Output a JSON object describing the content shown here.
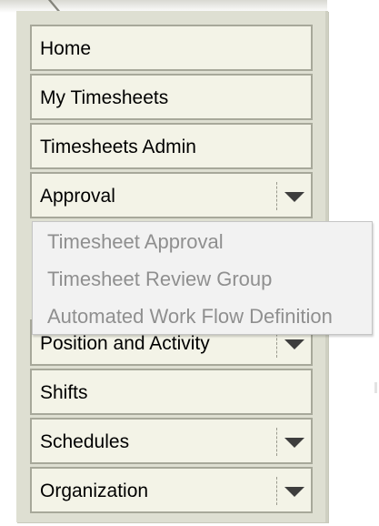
{
  "menu": {
    "items": [
      {
        "label": "Home",
        "has_dropdown": false
      },
      {
        "label": "My Timesheets",
        "has_dropdown": false
      },
      {
        "label": "Timesheets Admin",
        "has_dropdown": false
      },
      {
        "label": "Approval",
        "has_dropdown": true
      },
      {
        "label": "Position and Activity",
        "has_dropdown": true
      },
      {
        "label": "Shifts",
        "has_dropdown": false
      },
      {
        "label": "Schedules",
        "has_dropdown": true
      },
      {
        "label": "Organization",
        "has_dropdown": true
      }
    ]
  },
  "approval_submenu": {
    "items": [
      {
        "label": "Timesheet Approval"
      },
      {
        "label": "Timesheet Review Group"
      },
      {
        "label": "Automated Work Flow Definition"
      }
    ]
  },
  "colors": {
    "panel_bg": "#dedfd2",
    "item_bg": "#f3f3e7",
    "item_border": "#a7a89a",
    "submenu_bg": "#f2f2f2",
    "submenu_text": "#8f8f8f"
  },
  "icons": {
    "dropdown": "chevron-down-icon"
  }
}
